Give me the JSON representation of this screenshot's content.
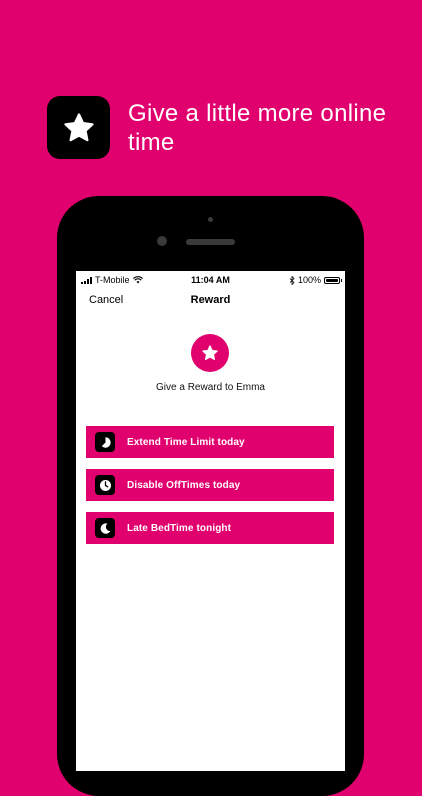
{
  "hero": {
    "icon": "star-icon",
    "title": "Give a little more online time"
  },
  "status_bar": {
    "carrier": "T-Mobile",
    "time": "11:04 AM",
    "battery": "100%"
  },
  "nav": {
    "cancel_label": "Cancel",
    "title": "Reward"
  },
  "reward": {
    "icon": "star-icon",
    "text": "Give a Reward to Emma"
  },
  "options": [
    {
      "icon": "time-limit-icon",
      "label": "Extend Time Limit today"
    },
    {
      "icon": "clock-icon",
      "label": "Disable OffTimes today"
    },
    {
      "icon": "moon-icon",
      "label": "Late BedTime tonight"
    }
  ],
  "colors": {
    "brand": "#E0006E",
    "icon_bg": "#000000",
    "screen_bg": "#FFFFFF"
  }
}
